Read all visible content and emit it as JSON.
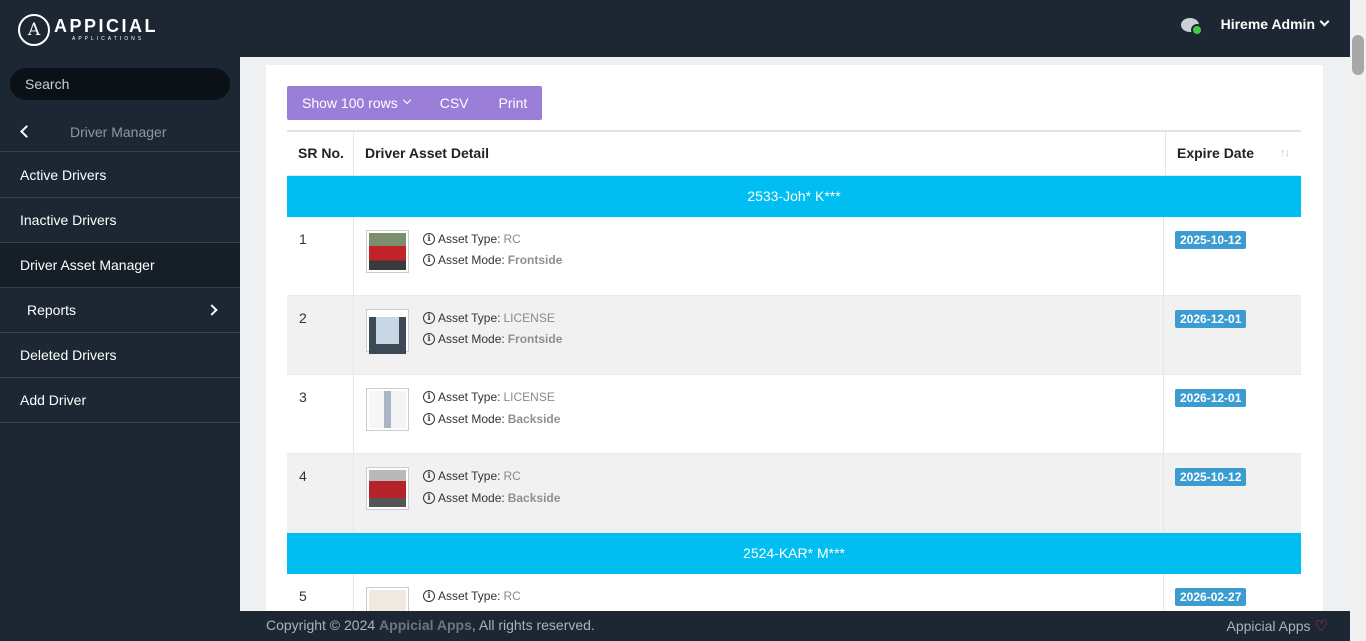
{
  "header": {
    "logo_title": "APPICIAL",
    "logo_subtitle": "APPLICATIONS",
    "logo_letter": "A",
    "user_name": "Hireme Admin"
  },
  "sidebar": {
    "search_placeholder": "Search",
    "section_title": "Driver Manager",
    "items": [
      {
        "label": "Active Drivers"
      },
      {
        "label": "Inactive Drivers"
      },
      {
        "label": "Driver Asset Manager"
      },
      {
        "label": "Reports"
      },
      {
        "label": "Deleted Drivers"
      },
      {
        "label": "Add Driver"
      }
    ]
  },
  "toolbar": {
    "show_rows_label": "Show 100 rows",
    "csv_label": "CSV",
    "print_label": "Print"
  },
  "table": {
    "columns": [
      "SR No.",
      "Driver Asset Detail",
      "Expire Date"
    ],
    "type_label": "Asset Type:",
    "mode_label": "Asset Mode:",
    "groups": [
      {
        "name": "2533-Joh* K***",
        "rows": [
          {
            "sr": "1",
            "asset_type": "RC",
            "asset_mode": "Frontside",
            "expire": "2025-10-12"
          },
          {
            "sr": "2",
            "asset_type": "LICENSE",
            "asset_mode": "Frontside",
            "expire": "2026-12-01"
          },
          {
            "sr": "3",
            "asset_type": "LICENSE",
            "asset_mode": "Backside",
            "expire": "2026-12-01"
          },
          {
            "sr": "4",
            "asset_type": "RC",
            "asset_mode": "Backside",
            "expire": "2025-10-12"
          }
        ]
      },
      {
        "name": "2524-KAR* M***",
        "rows": [
          {
            "sr": "5",
            "asset_type": "RC",
            "asset_mode": "",
            "expire": "2026-02-27"
          }
        ]
      }
    ]
  },
  "footer": {
    "copyright_prefix": "Copyright © 2024 ",
    "brand": "Appicial Apps",
    "copyright_suffix": ", All rights reserved.",
    "right_text": "Appicial Apps"
  },
  "colors": {
    "header_bg": "#1c2733",
    "group_row": "#00bef2",
    "button_group": "#9b7ed8",
    "badge": "#3a9cd1"
  }
}
